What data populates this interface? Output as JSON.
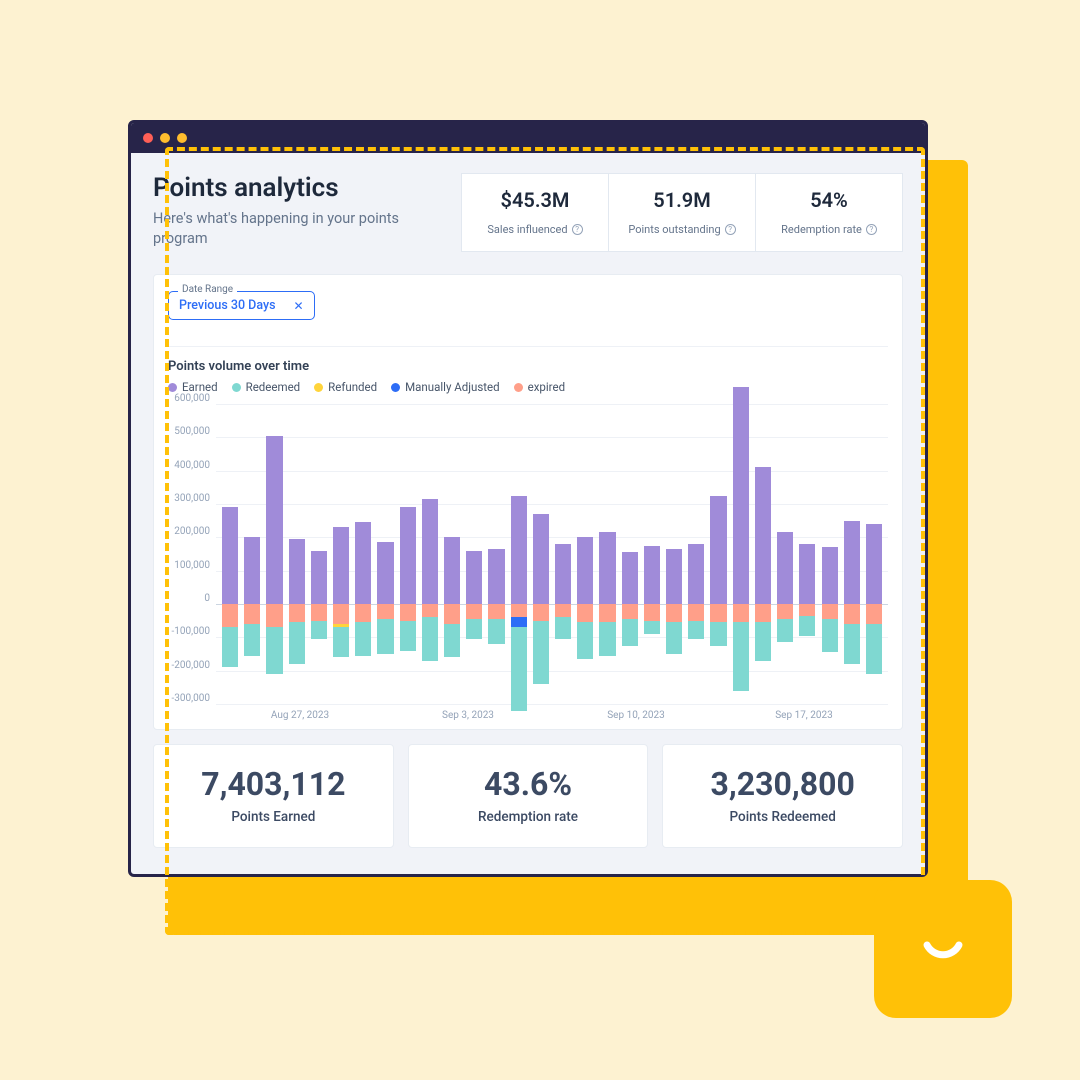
{
  "colors": {
    "earned": "#a08bd9",
    "redeemed": "#7fd8d1",
    "refunded": "#ffd43b",
    "manual": "#2d6df6",
    "expired": "#ff9f89"
  },
  "header": {
    "title": "Points analytics",
    "subtitle": "Here's what's happening in your points program"
  },
  "kpis": [
    {
      "value": "$45.3M",
      "label": "Sales influenced"
    },
    {
      "value": "51.9M",
      "label": "Points outstanding"
    },
    {
      "value": "54%",
      "label": "Redemption rate"
    }
  ],
  "date_range": {
    "label": "Date Range",
    "value": "Previous 30 Days"
  },
  "chart_title": "Points volume over time",
  "legend": [
    {
      "key": "earned",
      "label": "Earned"
    },
    {
      "key": "redeemed",
      "label": "Redeemed"
    },
    {
      "key": "refunded",
      "label": "Refunded"
    },
    {
      "key": "manual",
      "label": "Manually Adjusted"
    },
    {
      "key": "expired",
      "label": "expired"
    }
  ],
  "chart_data": {
    "type": "bar",
    "title": "Points volume over time",
    "ylabel": "",
    "xlabel": "",
    "ylim": [
      -300000,
      600000
    ],
    "y_ticks": [
      600000,
      500000,
      400000,
      300000,
      200000,
      100000,
      0,
      -100000,
      -200000,
      -300000
    ],
    "x_tick_labels": [
      "Aug 27, 2023",
      "Sep 3, 2023",
      "Sep 10, 2023",
      "Sep 17, 2023"
    ],
    "series_keys": [
      "earned",
      "refunded",
      "manual",
      "redeemed",
      "expired"
    ],
    "days": [
      {
        "earned": 290000,
        "refunded": 0,
        "manual": 0,
        "redeemed": -120000,
        "expired": -70000
      },
      {
        "earned": 200000,
        "refunded": 0,
        "manual": 0,
        "redeemed": -95000,
        "expired": -60000
      },
      {
        "earned": 505000,
        "refunded": 0,
        "manual": 0,
        "redeemed": -140000,
        "expired": -70000
      },
      {
        "earned": 195000,
        "refunded": 0,
        "manual": 0,
        "redeemed": -125000,
        "expired": -55000
      },
      {
        "earned": 160000,
        "refunded": 0,
        "manual": 0,
        "redeemed": -55000,
        "expired": -50000
      },
      {
        "earned": 230000,
        "refunded": -8000,
        "manual": 0,
        "redeemed": -90000,
        "expired": -60000
      },
      {
        "earned": 245000,
        "refunded": 0,
        "manual": 0,
        "redeemed": -100000,
        "expired": -55000
      },
      {
        "earned": 185000,
        "refunded": 0,
        "manual": 0,
        "redeemed": -105000,
        "expired": -45000
      },
      {
        "earned": 290000,
        "refunded": 0,
        "manual": 0,
        "redeemed": -90000,
        "expired": -50000
      },
      {
        "earned": 315000,
        "refunded": 0,
        "manual": 0,
        "redeemed": -130000,
        "expired": -40000
      },
      {
        "earned": 200000,
        "refunded": 0,
        "manual": 0,
        "redeemed": -100000,
        "expired": -60000
      },
      {
        "earned": 160000,
        "refunded": 0,
        "manual": 0,
        "redeemed": -60000,
        "expired": -45000
      },
      {
        "earned": 165000,
        "refunded": 0,
        "manual": 0,
        "redeemed": -75000,
        "expired": -45000
      },
      {
        "earned": 325000,
        "refunded": 0,
        "manual": -30000,
        "redeemed": -250000,
        "expired": -40000
      },
      {
        "earned": 270000,
        "refunded": 0,
        "manual": 0,
        "redeemed": -190000,
        "expired": -50000
      },
      {
        "earned": 180000,
        "refunded": 0,
        "manual": 0,
        "redeemed": -65000,
        "expired": -40000
      },
      {
        "earned": 200000,
        "refunded": 0,
        "manual": 0,
        "redeemed": -110000,
        "expired": -55000
      },
      {
        "earned": 215000,
        "refunded": 0,
        "manual": 0,
        "redeemed": -100000,
        "expired": -55000
      },
      {
        "earned": 155000,
        "refunded": 0,
        "manual": 0,
        "redeemed": -80000,
        "expired": -45000
      },
      {
        "earned": 175000,
        "refunded": 0,
        "manual": 0,
        "redeemed": -40000,
        "expired": -50000
      },
      {
        "earned": 165000,
        "refunded": 0,
        "manual": 0,
        "redeemed": -95000,
        "expired": -55000
      },
      {
        "earned": 180000,
        "refunded": 0,
        "manual": 0,
        "redeemed": -55000,
        "expired": -50000
      },
      {
        "earned": 325000,
        "refunded": 0,
        "manual": 0,
        "redeemed": -70000,
        "expired": -55000
      },
      {
        "earned": 650000,
        "refunded": 0,
        "manual": 0,
        "redeemed": -205000,
        "expired": -55000
      },
      {
        "earned": 410000,
        "refunded": 0,
        "manual": 0,
        "redeemed": -115000,
        "expired": -55000
      },
      {
        "earned": 215000,
        "refunded": 0,
        "manual": 0,
        "redeemed": -70000,
        "expired": -45000
      },
      {
        "earned": 180000,
        "refunded": 0,
        "manual": 0,
        "redeemed": -60000,
        "expired": -35000
      },
      {
        "earned": 170000,
        "refunded": 0,
        "manual": 0,
        "redeemed": -100000,
        "expired": -45000
      },
      {
        "earned": 250000,
        "refunded": 0,
        "manual": 0,
        "redeemed": -120000,
        "expired": -60000
      },
      {
        "earned": 240000,
        "refunded": 0,
        "manual": 0,
        "redeemed": -150000,
        "expired": -60000
      }
    ]
  },
  "stats": [
    {
      "value": "7,403,112",
      "label": "Points Earned"
    },
    {
      "value": "43.6%",
      "label": "Redemption rate"
    },
    {
      "value": "3,230,800",
      "label": "Points Redeemed"
    }
  ]
}
